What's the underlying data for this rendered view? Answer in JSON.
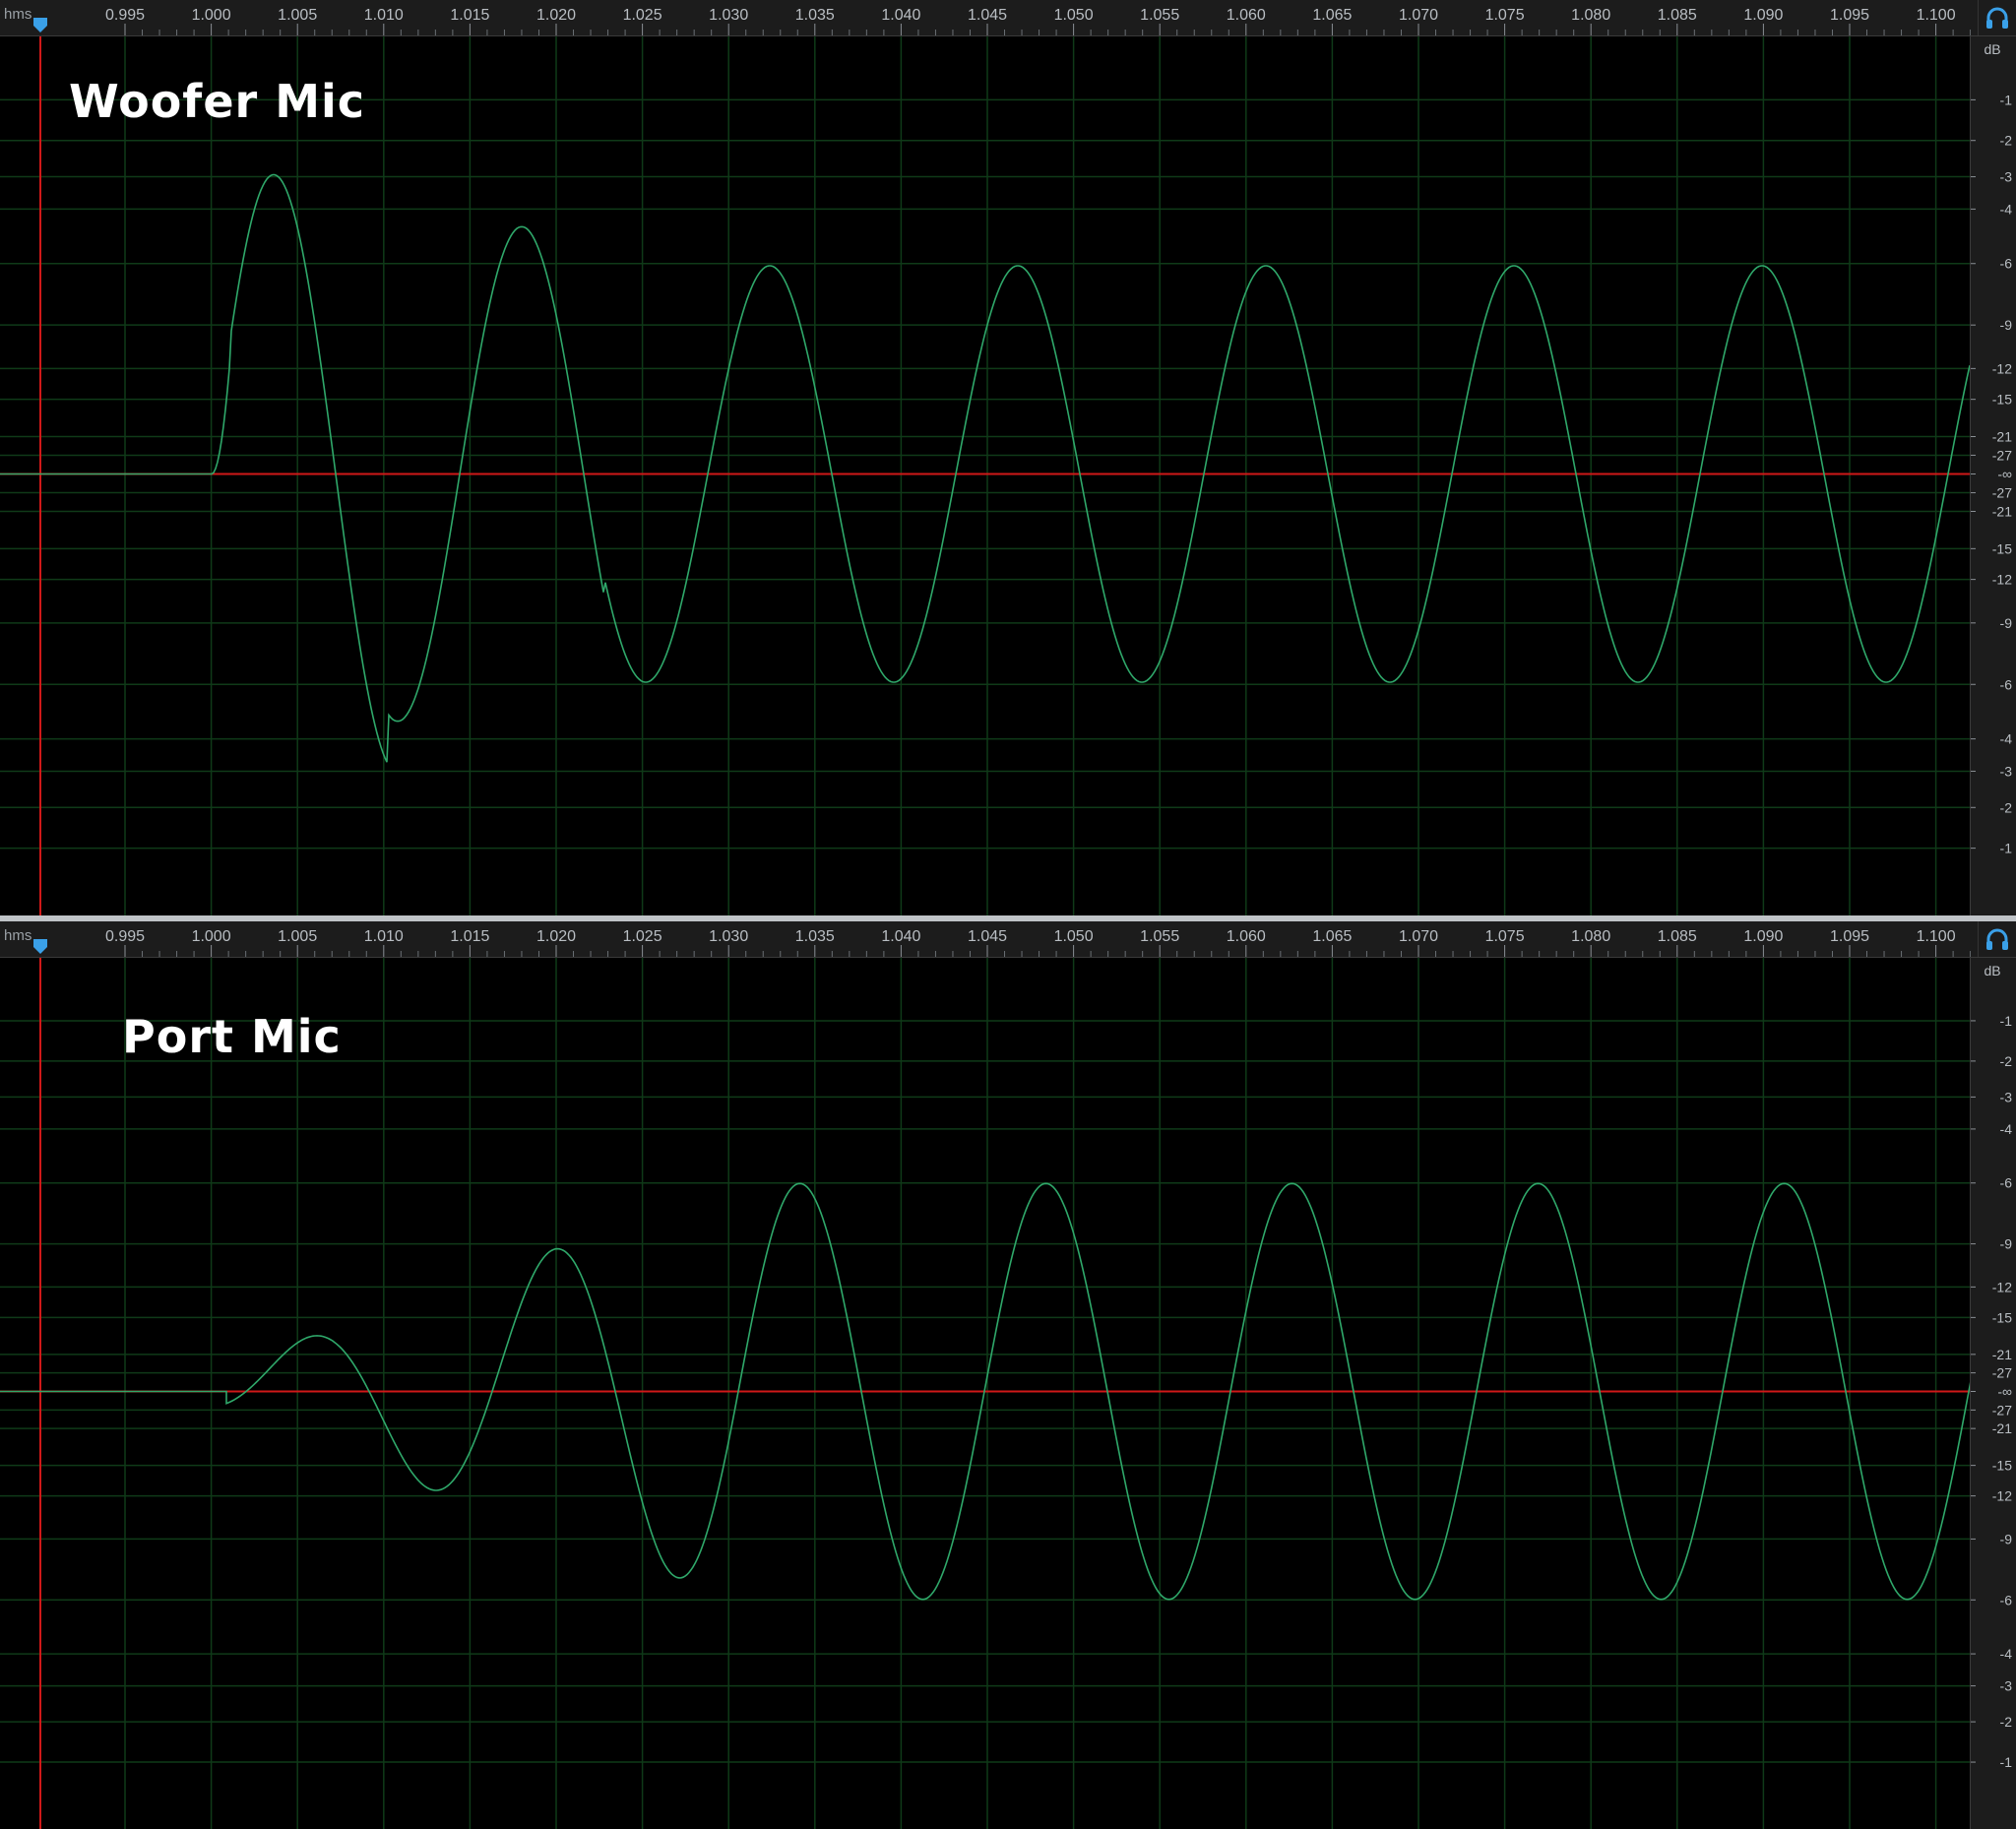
{
  "ruler": {
    "unit_label": "hms",
    "ticks": [
      "0.995",
      "1.000",
      "1.005",
      "1.010",
      "1.015",
      "1.020",
      "1.025",
      "1.030",
      "1.035",
      "1.040",
      "1.045",
      "1.050",
      "1.055",
      "1.060",
      "1.065",
      "1.070",
      "1.075",
      "1.080",
      "1.085",
      "1.090",
      "1.095",
      "1.100"
    ]
  },
  "db_scale": {
    "unit": "dB",
    "labels": [
      "-1",
      "-2",
      "-3",
      "-4",
      "-6",
      "-9",
      "-12",
      "-15",
      "-21",
      "-27",
      "-∞",
      "-27",
      "-21",
      "-15",
      "-12",
      "-9",
      "-6",
      "-4",
      "-3",
      "-2",
      "-1"
    ]
  },
  "panels": [
    {
      "id": "top",
      "title": "Woofer Mic"
    },
    {
      "id": "bottom",
      "title": "Port Mic"
    }
  ],
  "colors": {
    "background": "#000000",
    "grid": "#0f3a18",
    "waveform": "#2fa86a",
    "cursor_line": "#d01818",
    "zero_line": "#d01818",
    "playhead": "#3aa0e8",
    "headphone_icon": "#3aa0e8"
  },
  "icons": {
    "playhead": "playhead-marker-icon",
    "headphones": "headphones-icon"
  }
}
